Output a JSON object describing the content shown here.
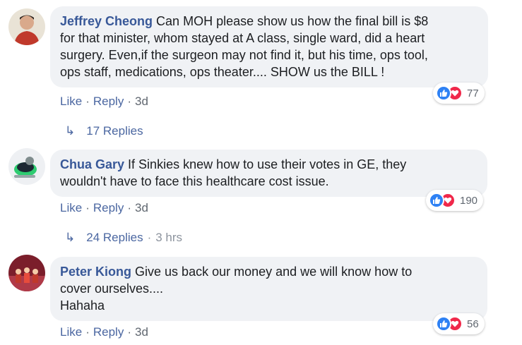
{
  "comments": [
    {
      "author": "Jeffrey Cheong",
      "text": "Can MOH please show us how the final bill is $8\nfor that minister, whom stayed at A class, single ward, did a heart\nsurgery. Even,if the surgeon may not find it, but his time, ops tool,\nops staff, medications, ops theater.... SHOW us the BILL !",
      "actions": {
        "like": "Like",
        "reply": "Reply",
        "time": "3d",
        "sep": "·"
      },
      "reactions": {
        "count": "77",
        "icons": [
          "like-icon",
          "love-icon"
        ]
      },
      "replies": {
        "label": "17 Replies",
        "time": ""
      }
    },
    {
      "author": "Chua Gary",
      "text": "If Sinkies knew how to use their votes in GE, they\nwouldn't have to face this healthcare cost issue.",
      "actions": {
        "like": "Like",
        "reply": "Reply",
        "time": "3d",
        "sep": "·"
      },
      "reactions": {
        "count": "190",
        "icons": [
          "like-icon",
          "love-icon"
        ]
      },
      "replies": {
        "label": "24 Replies",
        "time": "3 hrs",
        "sep": "·"
      }
    },
    {
      "author": "Peter Kiong",
      "text": "Give us back our money and we will know how to\ncover ourselves....\nHahaha",
      "actions": {
        "like": "Like",
        "reply": "Reply",
        "time": "3d",
        "sep": "·"
      },
      "reactions": {
        "count": "56",
        "icons": [
          "like-icon",
          "love-icon"
        ]
      }
    }
  ],
  "colors": {
    "author": "#385898",
    "link": "#4b67a1",
    "bubble": "#f0f2f5",
    "like": "#2e81f4",
    "love": "#f0284a"
  }
}
